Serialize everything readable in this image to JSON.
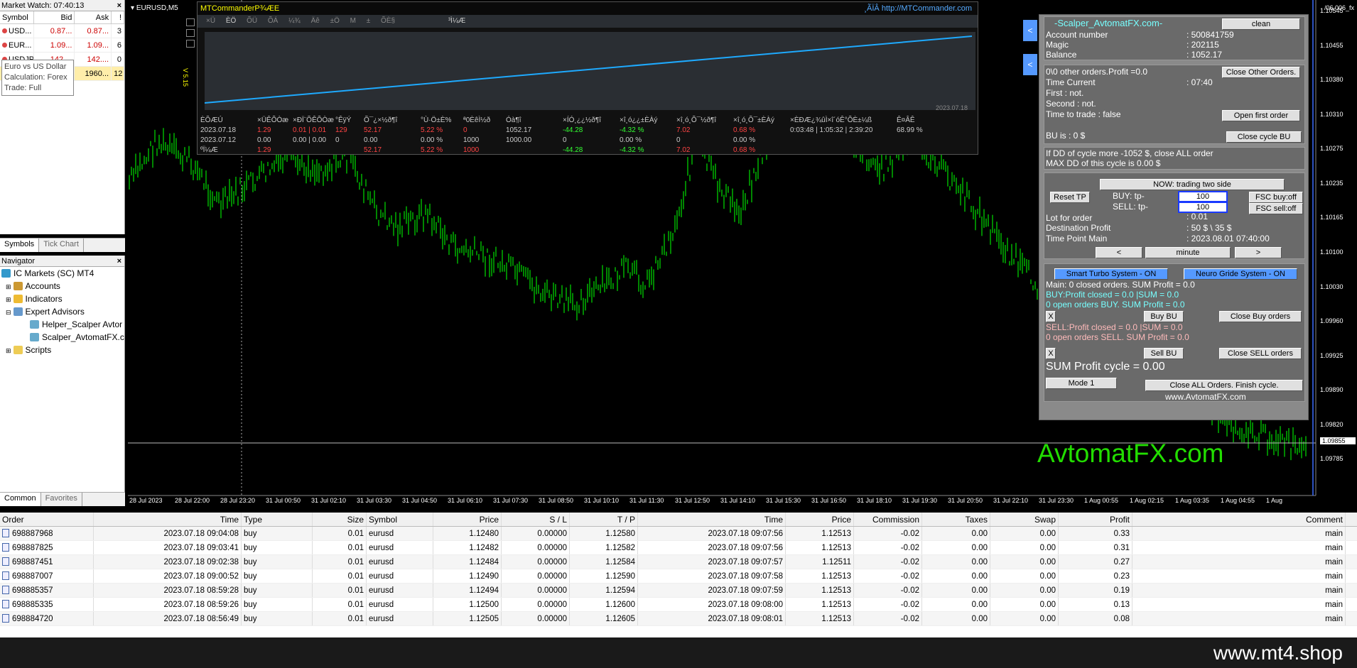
{
  "market_watch": {
    "title": "Market Watch: 07:40:13",
    "headers": [
      "Symbol",
      "Bid",
      "Ask",
      "!"
    ],
    "rows": [
      {
        "symbol": "USD...",
        "bid": "0.87...",
        "ask": "0.87...",
        "spread": "3"
      },
      {
        "symbol": "EUR...",
        "bid": "1.09...",
        "ask": "1.09...",
        "spread": "6"
      },
      {
        "symbol": "USDJPY",
        "bid": "142....",
        "ask": "142....",
        "spread": "0"
      },
      {
        "symbol": "",
        "bid": "",
        "ask": "1960...",
        "spread": "12"
      }
    ],
    "tooltip": [
      "Euro vs US Dollar",
      "Calculation: Forex",
      "Trade: Full"
    ],
    "tabs": [
      "Symbols",
      "Tick Chart"
    ]
  },
  "navigator": {
    "title": "Navigator",
    "root": "IC Markets (SC) MT4",
    "items": [
      "Accounts",
      "Indicators",
      "Expert Advisors",
      "Helper_Scalper Avtor",
      "Scalper_AvtomatFX.c",
      "Scripts"
    ],
    "tabs": [
      "Common",
      "Favorites"
    ]
  },
  "chart": {
    "title": "EURUSD,M5",
    "watermark": "AvtomatFX.com",
    "top_right": "/06.006_fx",
    "current_price": "1.09855",
    "y_ticks": [
      "1.10545",
      "1.10455",
      "1.10380",
      "1.10310",
      "1.10275",
      "1.10235",
      "1.10165",
      "1.10100",
      "1.10030",
      "1.09960",
      "1.09925",
      "1.09890",
      "1.09820",
      "1.09785"
    ],
    "x_ticks": [
      "28 Jul 2023",
      "28 Jul 22:00",
      "28 Jul 23:20",
      "31 Jul 00:50",
      "31 Jul 02:10",
      "31 Jul 03:30",
      "31 Jul 04:50",
      "31 Jul 06:10",
      "31 Jul 07:30",
      "31 Jul 08:50",
      "31 Jul 10:10",
      "31 Jul 11:30",
      "31 Jul 12:50",
      "31 Jul 14:10",
      "31 Jul 15:30",
      "31 Jul 16:50",
      "31 Jul 18:10",
      "31 Jul 19:30",
      "31 Jul 20:50",
      "31 Jul 22:10",
      "31 Jul 23:30",
      "1 Aug 00:55",
      "1 Aug 02:15",
      "1 Aug 03:35",
      "1 Aug 04:55",
      "1 Aug"
    ],
    "candle_color": "#00e000",
    "version": "V 5.15"
  },
  "mtc": {
    "title": "MTCommanderP¾ÆE",
    "link": "http://MTCommander.com",
    "icons": [
      "×Ü",
      "ÈÖ",
      "ÕÜ",
      "ÕÁ",
      "¼¾",
      "Äê",
      "±Ö",
      "M",
      "±",
      "ÕÈ§",
      "³Ì¼Æ"
    ],
    "graph_date": "2023.07.18",
    "line_color": "#1eaaff",
    "headers": [
      "ÈÕÆÚ",
      "×ÜÊÕÒæ",
      "×ÐÏ¨ÕÊÕÒæ",
      "°ÊÿÝ",
      "Õ¯¿×½ð¶î",
      "°Ù·Ö±È%",
      "ª0ÈêÌ½ð",
      "Óà¶î",
      "×ÍÓ¸¿¿½ð¶î",
      "×î¸ó¿¿±ÈÀý",
      "×î¸ó¸Õ¯½ð¶î",
      "×î¸ó¸Õ¯±ÈÀý",
      "×ÈÐÆ¿¾ûÌ×î´óÊ°ÕÈ±¼ß",
      "Ê¤ÂÊ"
    ],
    "rows": [
      [
        "2023.07.18",
        "1.29",
        "0.01 | 0.01",
        "129",
        "52.17",
        "5.22 %",
        "0",
        "1052.17",
        "-44.28",
        "-4.32 %",
        "7.02",
        "0.68 %",
        "0:03:48 | 1:05:32 | 2:39:20",
        "68.99 %"
      ],
      [
        "2023.07.12",
        "0.00",
        "0.00 | 0.00",
        "0",
        "0.00",
        "0.00 %",
        "1000",
        "1000.00",
        "0",
        "0.00 %",
        "0",
        "0.00 %",
        "",
        ""
      ],
      [
        "ºÏ¼Æ",
        "1.29",
        "",
        "",
        "52.17",
        "5.22 %",
        "1000",
        "",
        "-44.28",
        "-4.32 %",
        "7.02",
        "0.68 %",
        "",
        ""
      ]
    ]
  },
  "scalper": {
    "title": "-Scalper_AvtomatFX.com-",
    "clean": "clean",
    "account_label": "Account number",
    "account_value": ": 500841759",
    "magic_label": "Magic",
    "magic_value": ": 202115",
    "balance_label": "Balance",
    "balance_value": ": 1052.17",
    "other_orders": "0\\0 other orders.Profit =0.0",
    "close_other": "Close Other Orders.",
    "time_current_label": "Time Current",
    "time_current_value": ": 07:40",
    "first": "First     : not.",
    "second": "Second  : not.",
    "time_to_trade": "Time to trade :  false",
    "open_first": "Open first order",
    "bu_is": "BU is :  0 $",
    "close_cycle_bu": "Close cycle BU",
    "dd1": "If DD of cycle more -1052 $, close ALL order",
    "dd2": "MAX DD of this cycle is 0.00 $",
    "now_trading": "NOW: trading two side",
    "reset_tp": "Reset TP",
    "buy_tp": "BUY:   tp-",
    "sell_tp": "SELL:  tp-",
    "buy_val": "100",
    "sell_val": "100",
    "fsc_buy": "FSC buy:off",
    "fsc_sell": "FSC sell:off",
    "lot_label": "Lot for order",
    "lot_value": ": 0.01",
    "dest_label": "Destination Profit",
    "dest_value": ": 50 $ \\ 35 $",
    "tpm_label": "Time Point Main",
    "tpm_value": ": 2023.08.01 07:40:00",
    "prev": "<",
    "minute": "minute",
    "next": ">",
    "smart_turbo": "Smart Turbo System - ON",
    "neuro_grid": "Neuro Gride System - ON",
    "main_closed": "Main: 0 closed orders. SUM Profit = 0.0",
    "buy_closed": "BUY:Profit closed = 0.0 |SUM = 0.0",
    "buy_open": "0 open orders BUY. SUM Profit = 0.0",
    "x": "X",
    "buy_bu": "Buy BU",
    "close_buy": "Close Buy orders",
    "sell_closed": "SELL:Profit closed = 0.0 |SUM = 0.0",
    "sell_open": "0 open orders SELL. SUM Profit = 0.0",
    "sell_bu": "Sell BU",
    "close_sell": "Close SELL orders",
    "sum_profit": "SUM Profit cycle = 0.00",
    "mode": "Mode 1",
    "close_all": "Close ALL Orders. Finish cycle.",
    "site": "www.AvtomatFX.com",
    "side": "<"
  },
  "terminal": {
    "headers": [
      "Order",
      "Time",
      "Type",
      "Size",
      "Symbol",
      "Price",
      "S / L",
      "T / P",
      "Time",
      "Price",
      "Commission",
      "Taxes",
      "Swap",
      "Profit",
      "Comment"
    ],
    "rows": [
      [
        "698887968",
        "2023.07.18 09:04:08",
        "buy",
        "0.01",
        "eurusd",
        "1.12480",
        "0.00000",
        "1.12580",
        "2023.07.18 09:07:56",
        "1.12513",
        "-0.02",
        "0.00",
        "0.00",
        "0.33",
        "main"
      ],
      [
        "698887825",
        "2023.07.18 09:03:41",
        "buy",
        "0.01",
        "eurusd",
        "1.12482",
        "0.00000",
        "1.12582",
        "2023.07.18 09:07:56",
        "1.12513",
        "-0.02",
        "0.00",
        "0.00",
        "0.31",
        "main"
      ],
      [
        "698887451",
        "2023.07.18 09:02:38",
        "buy",
        "0.01",
        "eurusd",
        "1.12484",
        "0.00000",
        "1.12584",
        "2023.07.18 09:07:57",
        "1.12511",
        "-0.02",
        "0.00",
        "0.00",
        "0.27",
        "main"
      ],
      [
        "698887007",
        "2023.07.18 09:00:52",
        "buy",
        "0.01",
        "eurusd",
        "1.12490",
        "0.00000",
        "1.12590",
        "2023.07.18 09:07:58",
        "1.12513",
        "-0.02",
        "0.00",
        "0.00",
        "0.23",
        "main"
      ],
      [
        "698885357",
        "2023.07.18 08:59:28",
        "buy",
        "0.01",
        "eurusd",
        "1.12494",
        "0.00000",
        "1.12594",
        "2023.07.18 09:07:59",
        "1.12513",
        "-0.02",
        "0.00",
        "0.00",
        "0.19",
        "main"
      ],
      [
        "698885335",
        "2023.07.18 08:59:26",
        "buy",
        "0.01",
        "eurusd",
        "1.12500",
        "0.00000",
        "1.12600",
        "2023.07.18 09:08:00",
        "1.12513",
        "-0.02",
        "0.00",
        "0.00",
        "0.13",
        "main"
      ],
      [
        "698884720",
        "2023.07.18 08:56:49",
        "buy",
        "0.01",
        "eurusd",
        "1.12505",
        "0.00000",
        "1.12605",
        "2023.07.18 09:08:01",
        "1.12513",
        "-0.02",
        "0.00",
        "0.00",
        "0.08",
        "main"
      ]
    ]
  },
  "footer": "www.mt4.shop"
}
